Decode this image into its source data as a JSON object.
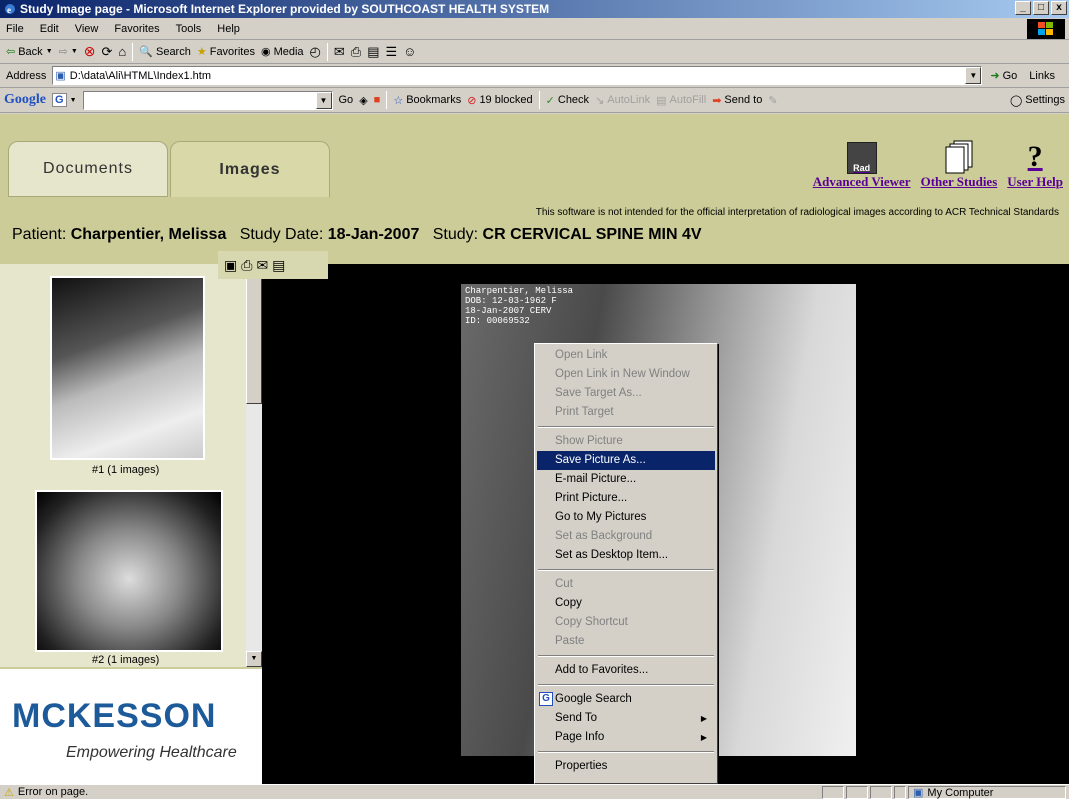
{
  "window": {
    "title": "Study Image page - Microsoft Internet Explorer provided by SOUTHCOAST HEALTH SYSTEM",
    "min": "_",
    "max": "□",
    "close": "x"
  },
  "menu": [
    "File",
    "Edit",
    "View",
    "Favorites",
    "Tools",
    "Help"
  ],
  "toolbar": {
    "back": "Back",
    "search": "Search",
    "favorites": "Favorites",
    "media": "Media"
  },
  "address": {
    "label": "Address",
    "value": "D:\\data\\Ali\\HTML\\Index1.htm",
    "go": "Go",
    "links": "Links"
  },
  "google": {
    "logo": "Google",
    "g_button": "G",
    "go": "Go",
    "bookmarks": "Bookmarks",
    "blocked": "19 blocked",
    "check": "Check",
    "autolink": "AutoLink",
    "autofill": "AutoFill",
    "sendto": "Send to",
    "settings": "Settings"
  },
  "tabs": {
    "documents": "Documents",
    "images": "Images"
  },
  "links": {
    "advanced_viewer": "Advanced Viewer",
    "other_studies": "Other Studies",
    "user_help": "User Help",
    "rad_badge": "Rad"
  },
  "disclaimer": "This software is not intended for the official interpretation of radiological images according to ACR Technical Standards",
  "patient": {
    "label": "Patient:",
    "name": "Charpentier, Melissa",
    "date_label": "Study Date:",
    "date": "18-Jan-2007",
    "study_label": "Study:",
    "study": "CR  CERVICAL SPINE MIN 4V"
  },
  "thumbnails": [
    {
      "caption": "#1 (1 images)"
    },
    {
      "caption": "#2 (1 images)"
    }
  ],
  "logo": {
    "name": "MCKESSON",
    "tagline": "Empowering Healthcare"
  },
  "xray_overlay": {
    "line1": "Charpentier, Melissa",
    "line2": "DOB: 12-03-1962 F",
    "line3": "18-Jan-2007 CERV",
    "line4": "ID: 00069532"
  },
  "context_menu": {
    "groups": [
      [
        {
          "label": "Open Link",
          "disabled": true
        },
        {
          "label": "Open Link in New Window",
          "disabled": true
        },
        {
          "label": "Save Target As...",
          "disabled": true
        },
        {
          "label": "Print Target",
          "disabled": true
        }
      ],
      [
        {
          "label": "Show Picture",
          "disabled": true
        },
        {
          "label": "Save Picture As...",
          "highlighted": true
        },
        {
          "label": "E-mail Picture..."
        },
        {
          "label": "Print Picture..."
        },
        {
          "label": "Go to My Pictures"
        },
        {
          "label": "Set as Background",
          "disabled": true
        },
        {
          "label": "Set as Desktop Item..."
        }
      ],
      [
        {
          "label": "Cut",
          "disabled": true
        },
        {
          "label": "Copy"
        },
        {
          "label": "Copy Shortcut",
          "disabled": true
        },
        {
          "label": "Paste",
          "disabled": true
        }
      ],
      [
        {
          "label": "Add to Favorites..."
        }
      ],
      [
        {
          "label": "Google Search"
        },
        {
          "label": "Send To",
          "submenu": true
        },
        {
          "label": "Page Info",
          "submenu": true
        }
      ],
      [
        {
          "label": "Properties"
        }
      ]
    ]
  },
  "status": {
    "left": "Error on page.",
    "zone": "My Computer"
  }
}
